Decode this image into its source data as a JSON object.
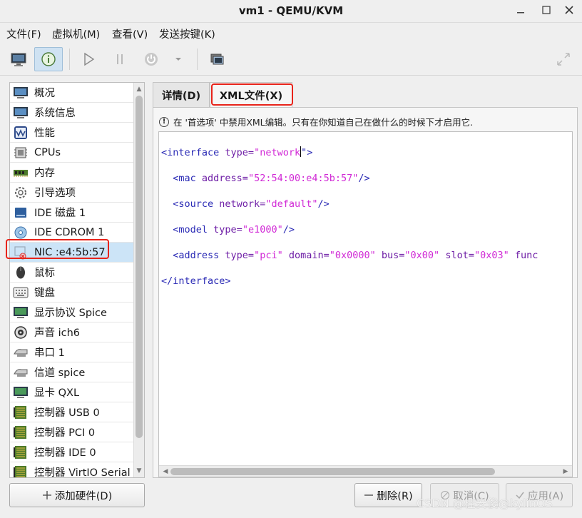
{
  "window": {
    "title": "vm1 - QEMU/KVM"
  },
  "menubar": [
    "文件(F)",
    "虚拟机(M)",
    "查看(V)",
    "发送按键(K)"
  ],
  "toolbar": {
    "buttons": [
      "monitor-icon",
      "info-icon",
      "play-icon",
      "pause-icon",
      "power-icon",
      "dropdown-icon",
      "snapshots-icon",
      "fullscreen-icon"
    ]
  },
  "sidebar": {
    "items": [
      {
        "label": "概况",
        "icon": "overview-icon"
      },
      {
        "label": "系统信息",
        "icon": "sysinfo-icon"
      },
      {
        "label": "性能",
        "icon": "performance-icon"
      },
      {
        "label": "CPUs",
        "icon": "cpu-icon"
      },
      {
        "label": "内存",
        "icon": "memory-icon"
      },
      {
        "label": "引导选项",
        "icon": "boot-gear-icon"
      },
      {
        "label": "IDE 磁盘 1",
        "icon": "disk-icon"
      },
      {
        "label": "IDE CDROM 1",
        "icon": "cdrom-icon"
      },
      {
        "label": "NIC :e4:5b:57",
        "icon": "nic-icon",
        "selected": true
      },
      {
        "label": "鼠标",
        "icon": "mouse-icon"
      },
      {
        "label": "键盘",
        "icon": "keyboard-icon"
      },
      {
        "label": "显示协议 Spice",
        "icon": "display-icon"
      },
      {
        "label": "声音 ich6",
        "icon": "sound-icon"
      },
      {
        "label": "串口 1",
        "icon": "serial-icon"
      },
      {
        "label": "信道 spice",
        "icon": "channel-icon"
      },
      {
        "label": "显卡 QXL",
        "icon": "video-icon"
      },
      {
        "label": "控制器 USB 0",
        "icon": "controller-icon"
      },
      {
        "label": "控制器 PCI 0",
        "icon": "controller-icon"
      },
      {
        "label": "控制器 IDE 0",
        "icon": "controller-icon"
      },
      {
        "label": "控制器 VirtIO Serial",
        "icon": "controller-icon"
      }
    ]
  },
  "add_hardware": {
    "label": "添加硬件(D)",
    "icon": "plus-icon"
  },
  "tabs": {
    "details": "详情(D)",
    "xml": "XML文件(X)"
  },
  "warning": "在 '首选项' 中禁用XML编辑。只有在你知道自己在做什么的时候下才启用它.",
  "xml": {
    "line1": {
      "tag": "<interface",
      "attr": " type=",
      "val": "\"network",
      "end": "\">"
    },
    "line2": {
      "tag": "  <mac",
      "attr": " address=",
      "val": "\"52:54:00:e4:5b:57\"",
      "end": "/>"
    },
    "line3": {
      "tag": "  <source",
      "attr": " network=",
      "val": "\"default\"",
      "end": "/>"
    },
    "line4": {
      "tag": "  <model",
      "attr": " type=",
      "val": "\"e1000\"",
      "end": "/>"
    },
    "line5": {
      "tag": "  <address",
      "a1": " type=",
      "v1": "\"pci\"",
      "a2": " domain=",
      "v2": "\"0x0000\"",
      "a3": " bus=",
      "v3": "\"0x00\"",
      "a4": " slot=",
      "v4": "\"0x03\"",
      "a5": " func"
    },
    "line6": "</interface>"
  },
  "buttons": {
    "remove": "删除(R)",
    "cancel": "取消(C)",
    "apply": "应用(A)"
  },
  "watermark": "CSDN @桂安俊@kylinOS",
  "colors": {
    "highlight": "#e8231a",
    "selection": "#cce4f7",
    "xml_tag": "#2a2ab5",
    "xml_attr": "#6e1ea6",
    "xml_value": "#d12ad6"
  }
}
